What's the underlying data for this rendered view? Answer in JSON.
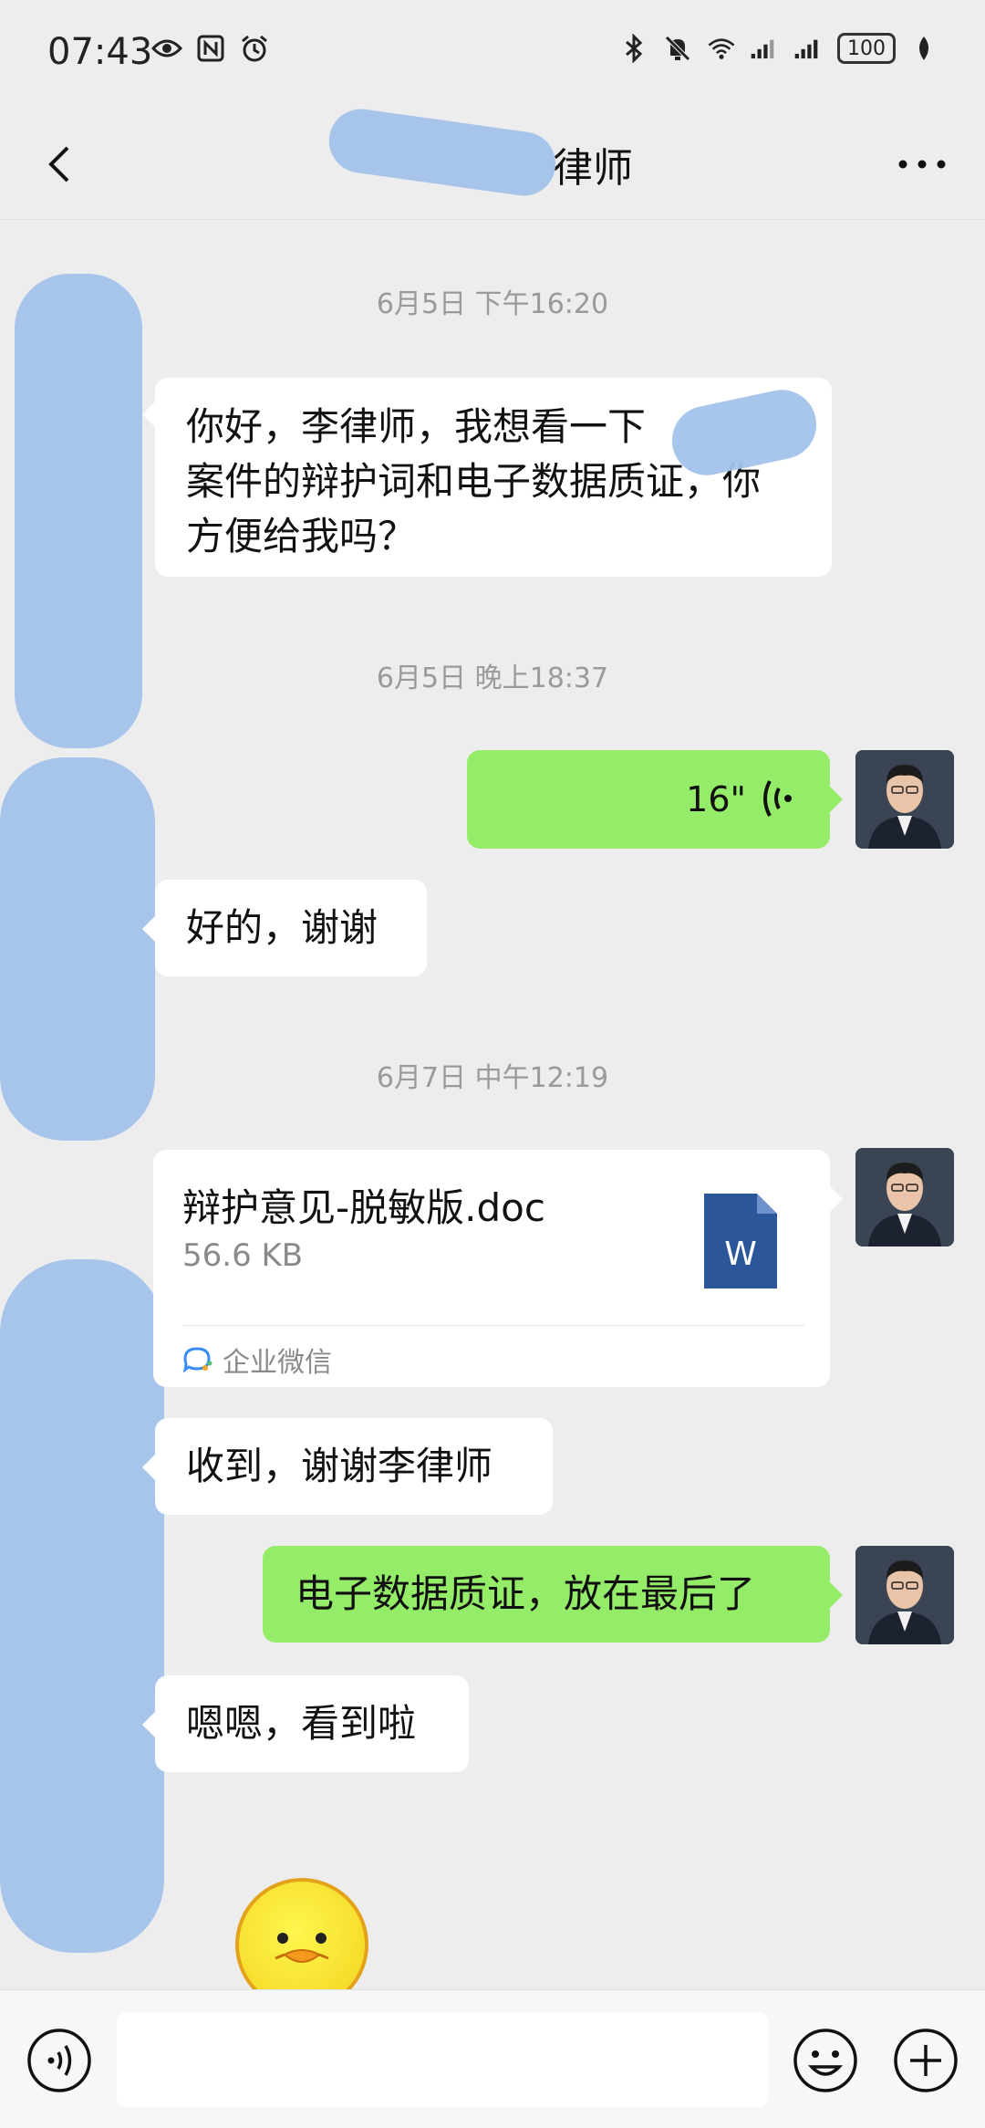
{
  "status_bar": {
    "time": "07:43",
    "left_icons": [
      "eye-icon",
      "nfc-icon",
      "alarm-icon"
    ],
    "right_icons": [
      "bluetooth-icon",
      "mute-icon",
      "wifi-icon",
      "signal-icon",
      "signal-icon"
    ],
    "battery": "100"
  },
  "nav": {
    "title": "律师"
  },
  "messages": {
    "ts1": "6月5日 下午16:20",
    "m1_line1": "你好，李律师，我想看一下",
    "m1_line2": "案件的辩护词和电子数据质证，你",
    "m1_line3": "方便给我吗？",
    "ts2": "6月5日 晚上18:37",
    "voice_duration": "16\"",
    "m3": "好的，谢谢",
    "ts3": "6月7日 中午12:19",
    "file": {
      "name": "辩护意见-脱敏版.doc",
      "size": "56.6 KB",
      "source": "企业微信",
      "icon_letter": "W"
    },
    "m5": "收到，谢谢李律师",
    "m6": "电子数据质证，放在最后了",
    "m7": "嗯嗯，看到啦"
  },
  "colors": {
    "background": "#ededed",
    "my_bubble": "#95ec69",
    "their_bubble": "#ffffff",
    "word_blue": "#2b579a"
  }
}
